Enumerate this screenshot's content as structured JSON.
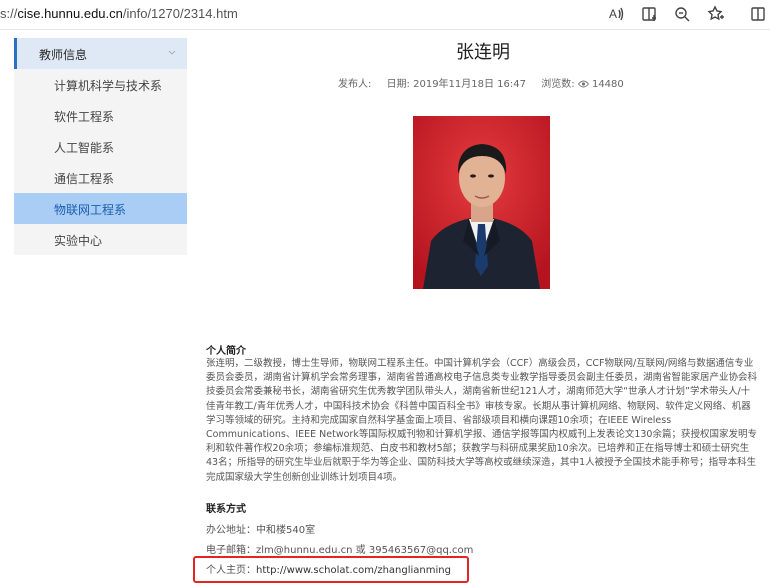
{
  "browser": {
    "url_prefix": "s://",
    "url_host": "cise.hunnu.edu.cn",
    "url_path": "/info/1270/2314.htm",
    "icons": [
      "read-aloud-icon",
      "reading-view-icon",
      "zoom-icon",
      "add-favorite-icon",
      "split-screen-icon"
    ]
  },
  "sidebar": {
    "header": "教师信息",
    "items": [
      {
        "label": "计算机科学与技术系"
      },
      {
        "label": "软件工程系"
      },
      {
        "label": "人工智能系"
      },
      {
        "label": "通信工程系"
      },
      {
        "label": "物联网工程系",
        "active": true
      },
      {
        "label": "实验中心"
      }
    ],
    "active_color": "#a9cdf5"
  },
  "article": {
    "title": "张连明",
    "publisher_label": "发布人:",
    "date_label": "日期: 2019年11月18日 16:47",
    "views_label": "浏览数:",
    "views_count": "14480"
  },
  "profile": {
    "intro_heading": "个人简介",
    "intro_text": "张连明，二级教授，博士生导师，物联网工程系主任。中国计算机学会（CCF）高级会员，CCF物联网/互联网/网络与数据通信专业委员会委员，湖南省计算机学会常务理事，湖南省普通高校电子信息类专业教学指导委员会副主任委员，湖南省智能家居产业协会科技委员会常委兼秘书长，湖南省研究生优秀教学团队带头人，湖南省新世纪121人才，湖南师范大学“世承人才计划”学术带头人/十佳青年教工/青年优秀人才，中国科技术协会《科普中国百科全书》审核专家。长期从事计算机网络、物联网、软件定义网络、机器学习等领域的研究。主持和完成国家自然科学基金面上项目、省部级项目和横向课题10余项；在IEEE Wireless Communications、IEEE Network等国际权威刊物和计算机学报、通信学报等国内权威刊上发表论文130余篇；获授权国家发明专利和软件著作权20余项；参编标准规范、白皮书和教材5部；获教学与科研成果奖励10余次。已培养和正在指导博士和硕士研究生43名；所指导的研究生毕业后就职于华为等企业、国防科技大学等高校或继续深造，其中1人被授予全国技术能手称号；指导本科生完成国家级大学生创新创业训练计划项目4项。",
    "contact_heading": "联系方式",
    "address": "办公地址：中和楼540室",
    "email": "电子邮箱：zlm@hunnu.edu.cn 或 395463567@qq.com",
    "homepage_label": "个人主页：",
    "homepage_url": "http://www.scholat.com/zhanglianming"
  },
  "highlight_color": "#e52424"
}
